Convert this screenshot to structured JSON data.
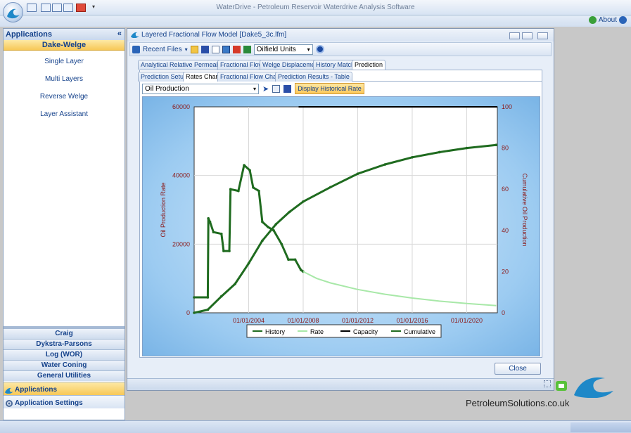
{
  "app": {
    "title": "WaterDrive - Petroleum Reservoir Waterdrive Analysis Software",
    "about_label": "About"
  },
  "left_panel": {
    "header": "Applications",
    "collapse_glyph": "«",
    "selected_group": "Dake-Welge",
    "items": [
      "Single Layer",
      "Multi Layers",
      "Reverse Welge",
      "Layer Assistant"
    ],
    "groups": [
      "Craig",
      "Dykstra-Parsons",
      "Log (WOR)",
      "Water Coning",
      "General Utilities"
    ],
    "nav": [
      {
        "label": "Applications",
        "active": true
      },
      {
        "label": "Application Settings",
        "active": false
      }
    ]
  },
  "window": {
    "title": "Layered Fractional Flow Model [Dake5_3c.lfm]",
    "toolbar": {
      "recent_files": "Recent Files",
      "units": "Oilfield Units"
    },
    "tabs": [
      "Analytical Relative Permeability",
      "Fractional Flow",
      "Welge Displacement",
      "History Match",
      "Prediction"
    ],
    "active_tab": "Prediction",
    "subtabs": [
      "Prediction Setup",
      "Rates Chart",
      "Fractional Flow Charts",
      "Prediction Results - Table"
    ],
    "active_subtab": "Rates Chart",
    "chart_select": "Oil Production",
    "historical_button": "Display Historical Rate",
    "close_label": "Close"
  },
  "chart_data": {
    "type": "line",
    "ylabel": "Oil Production Rate",
    "y2label": "Cumulative Oil Production",
    "ylim": [
      0,
      60000
    ],
    "y2lim": [
      0,
      100
    ],
    "yticks": [
      "0",
      "20000",
      "40000",
      "60000"
    ],
    "y2ticks": [
      "0",
      "20",
      "40",
      "60",
      "80",
      "100"
    ],
    "xticks": [
      "01/01/2004",
      "01/01/2008",
      "01/01/2012",
      "01/01/2016",
      "01/01/2020"
    ],
    "xlim": [
      "2000-01-01",
      "2022-04-01"
    ],
    "grid": true,
    "legend_position": "bottom",
    "series": [
      {
        "name": "History",
        "color": "#1f6b1f",
        "points": [
          [
            "2000-01-01",
            4500
          ],
          [
            "2001-01-01",
            4500
          ],
          [
            "2001-01-15",
            27500
          ],
          [
            "2001-03-01",
            26500
          ],
          [
            "2001-06-01",
            23500
          ],
          [
            "2002-01-01",
            23000
          ],
          [
            "2002-03-01",
            18000
          ],
          [
            "2002-08-01",
            18000
          ],
          [
            "2002-09-01",
            36000
          ],
          [
            "2003-04-01",
            35500
          ],
          [
            "2003-09-01",
            43000
          ],
          [
            "2004-02-01",
            41500
          ],
          [
            "2004-05-01",
            36500
          ],
          [
            "2004-10-01",
            35500
          ],
          [
            "2005-01-01",
            26500
          ],
          [
            "2005-06-01",
            25000
          ],
          [
            "2005-11-01",
            24000
          ],
          [
            "2006-06-01",
            20000
          ],
          [
            "2006-12-01",
            15500
          ],
          [
            "2007-06-01",
            15500
          ],
          [
            "2007-11-01",
            12500
          ],
          [
            "2008-01-01",
            12000
          ]
        ]
      },
      {
        "name": "Rate",
        "color": "#a8e8a8",
        "points": [
          [
            "2008-01-01",
            12000
          ],
          [
            "2009-01-01",
            10000
          ],
          [
            "2010-01-01",
            8700
          ],
          [
            "2012-01-01",
            6800
          ],
          [
            "2014-01-01",
            5400
          ],
          [
            "2016-01-01",
            4300
          ],
          [
            "2018-01-01",
            3400
          ],
          [
            "2020-01-01",
            2700
          ],
          [
            "2022-03-01",
            2100
          ]
        ]
      },
      {
        "name": "Capacity",
        "color": "#000000",
        "points": [
          [
            "2007-09-01",
            60000
          ],
          [
            "2022-04-01",
            60000
          ]
        ]
      },
      {
        "name": "Cumulative",
        "color": "#1f6b1f",
        "axis": "right",
        "points": [
          [
            "2000-01-01",
            0
          ],
          [
            "2001-01-01",
            1.5
          ],
          [
            "2002-01-01",
            8
          ],
          [
            "2003-01-01",
            14
          ],
          [
            "2004-01-01",
            24
          ],
          [
            "2005-01-01",
            35
          ],
          [
            "2006-01-01",
            43
          ],
          [
            "2007-01-01",
            49
          ],
          [
            "2008-01-01",
            54
          ],
          [
            "2010-01-01",
            61
          ],
          [
            "2012-01-01",
            67.5
          ],
          [
            "2014-01-01",
            72
          ],
          [
            "2016-01-01",
            75.5
          ],
          [
            "2018-01-01",
            78
          ],
          [
            "2020-01-01",
            80
          ],
          [
            "2022-03-01",
            81.5
          ]
        ]
      }
    ]
  },
  "brand": "PetroleumSolutions.co.uk",
  "colors": {
    "accent": "#f7c857",
    "header_text": "#15428b"
  }
}
